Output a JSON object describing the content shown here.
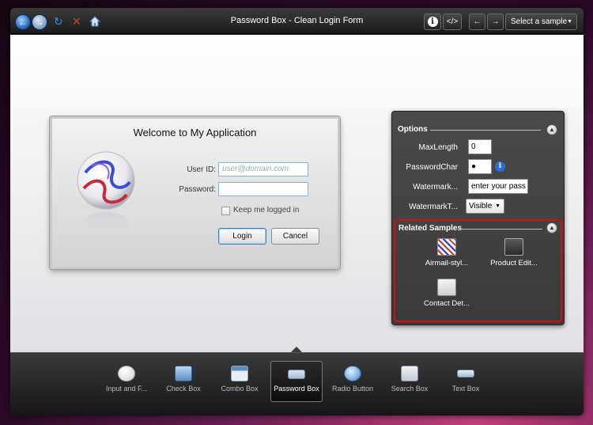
{
  "window": {
    "title": "Password Box - Clean Login Form"
  },
  "toolbar": {
    "back_icon": "back-arrow-icon",
    "forward_icon": "forward-arrow-icon",
    "refresh_icon": "refresh-icon",
    "stop_icon": "close-icon",
    "home_icon": "home-icon",
    "info_label": "i",
    "code_label": "</>",
    "prev_label": "←",
    "next_label": "→",
    "select_sample_label": "Select a sample"
  },
  "login": {
    "title": "Welcome to My Application",
    "userid_label": "User ID:",
    "userid_placeholder": "user@domain.com",
    "password_label": "Password:",
    "password_value": "",
    "keep_logged_label": "Keep me logged in",
    "keep_logged_checked": false,
    "login_button": "Login",
    "cancel_button": "Cancel"
  },
  "options": {
    "header": "Options",
    "maxlength_label": "MaxLength",
    "maxlength_value": "0",
    "passwordchar_label": "PasswordChar",
    "passwordchar_value": "●",
    "watermark_label": "Watermark...",
    "watermark_value": "enter your pass",
    "watermarkt_label": "WatermarkT...",
    "watermarkt_value": "Visible"
  },
  "related": {
    "header": "Related Samples",
    "items": [
      {
        "label": "Airmail-styl..."
      },
      {
        "label": "Product Edit..."
      },
      {
        "label": "Contact Det..."
      }
    ]
  },
  "bottom_nav": {
    "items": [
      {
        "label": "Input and F...",
        "selected": false
      },
      {
        "label": "Check Box",
        "selected": false
      },
      {
        "label": "Combo Box",
        "selected": false
      },
      {
        "label": "Password Box",
        "selected": true
      },
      {
        "label": "Radio Button",
        "selected": false
      },
      {
        "label": "Search Box",
        "selected": false
      },
      {
        "label": "Text Box",
        "selected": false
      }
    ]
  },
  "colors": {
    "accent_blue": "#2f6fbf",
    "highlight_red": "#d01010",
    "panel_dark": "#3f3f3f"
  }
}
